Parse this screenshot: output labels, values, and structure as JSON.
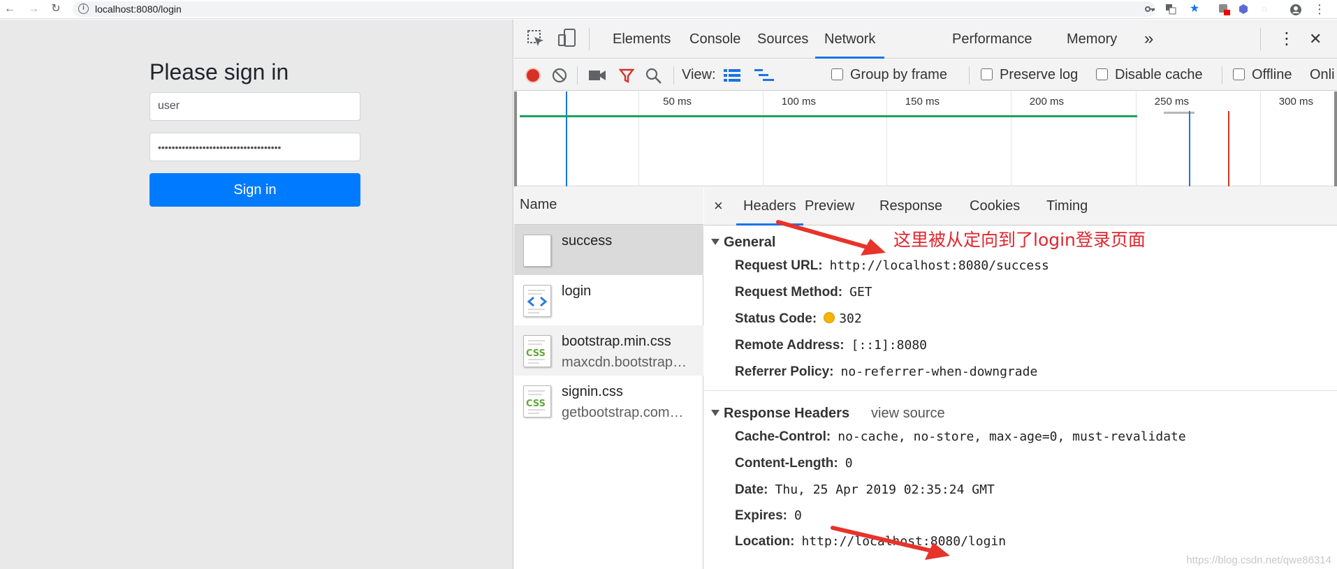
{
  "browser": {
    "url": "localhost:8080/login",
    "back_glyph": "←",
    "forward_glyph": "→",
    "reload_glyph": "↻",
    "info_glyph": "i"
  },
  "page": {
    "title": "Please sign in",
    "username_value": "user",
    "password_value": "••••••••••••••••••••••••••••••••••••",
    "signin_label": "Sign in"
  },
  "devtools": {
    "tabs": [
      "Elements",
      "Console",
      "Sources",
      "Network",
      "Performance",
      "Memory"
    ],
    "active_tab": "Network",
    "more_glyph": "»",
    "kebab_glyph": "⋮",
    "close_glyph": "✕",
    "toolbar": {
      "view_label": "View:",
      "group_by_frame": "Group by frame",
      "preserve_log": "Preserve log",
      "disable_cache": "Disable cache",
      "offline": "Offline",
      "online": "Onli"
    },
    "overview_ticks": [
      "50 ms",
      "100 ms",
      "150 ms",
      "200 ms",
      "250 ms",
      "300 ms"
    ],
    "name_header": "Name",
    "requests": [
      {
        "name": "success",
        "domain": "",
        "type": "document"
      },
      {
        "name": "login",
        "domain": "",
        "type": "html"
      },
      {
        "name": "bootstrap.min.css",
        "domain": "maxcdn.bootstrap…",
        "type": "css"
      },
      {
        "name": "signin.css",
        "domain": "getbootstrap.com…",
        "type": "css"
      }
    ],
    "detail_close": "×",
    "detail_tabs": [
      "Headers",
      "Preview",
      "Response",
      "Cookies",
      "Timing"
    ],
    "active_detail_tab": "Headers",
    "general": {
      "title": "General",
      "rows": [
        {
          "k": "Request URL:",
          "v": "http://localhost:8080/success"
        },
        {
          "k": "Request Method:",
          "v": "GET"
        },
        {
          "k": "Status Code:",
          "v": "302"
        },
        {
          "k": "Remote Address:",
          "v": "[::1]:8080"
        },
        {
          "k": "Referrer Policy:",
          "v": "no-referrer-when-downgrade"
        }
      ]
    },
    "response_headers": {
      "title": "Response Headers",
      "view_source": "view source",
      "rows": [
        {
          "k": "Cache-Control:",
          "v": "no-cache, no-store, max-age=0, must-revalidate"
        },
        {
          "k": "Content-Length:",
          "v": "0"
        },
        {
          "k": "Date:",
          "v": "Thu, 25 Apr 2019 02:35:24 GMT"
        },
        {
          "k": "Expires:",
          "v": "0"
        },
        {
          "k": "Location:",
          "v": "http://localhost:8080/login"
        }
      ]
    }
  },
  "annotation": {
    "text": "这里被从定向到了login登录页面",
    "color": "#e0262d"
  },
  "watermark": "https://blog.csdn.net/qwe86314",
  "colors": {
    "accent": "#1a73e8",
    "primary_button": "#007bff",
    "record": "#d93025",
    "status_dot": "#f5b400"
  }
}
